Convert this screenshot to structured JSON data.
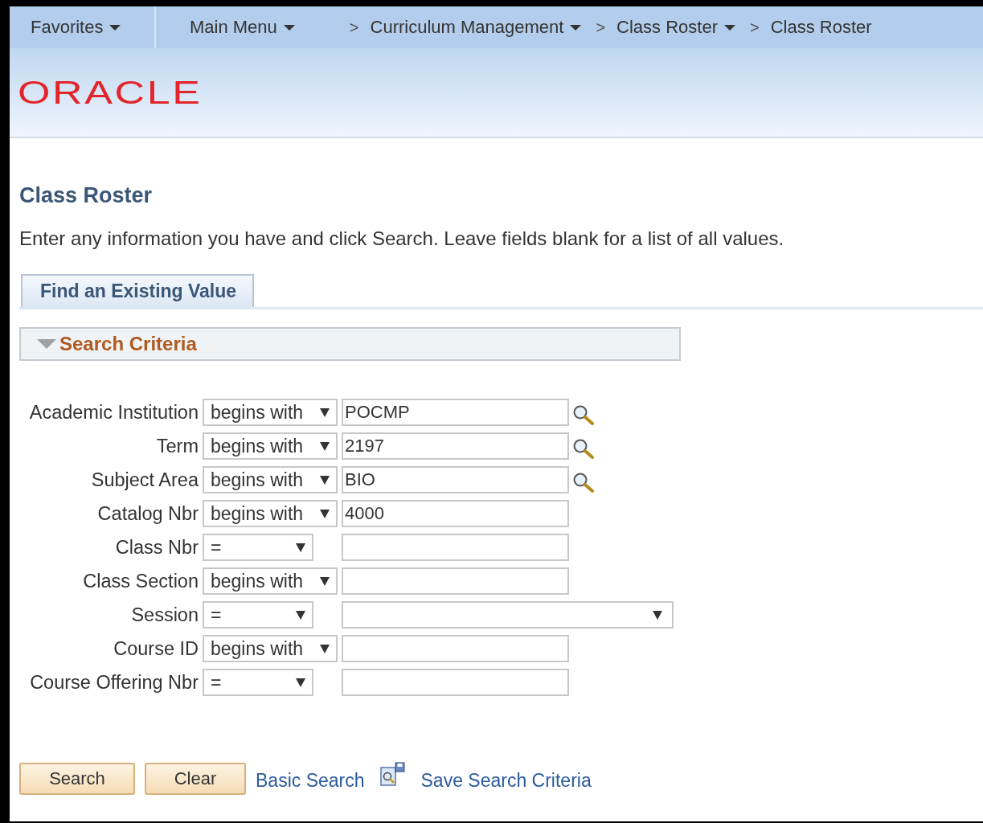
{
  "nav": [
    {
      "label": "Favorites",
      "has_menu": true
    },
    {
      "label": "Main Menu",
      "has_menu": true
    },
    {
      "label": "Curriculum Management",
      "has_menu": true,
      "separator": ">"
    },
    {
      "label": "Class Roster",
      "has_menu": true,
      "separator": ">"
    },
    {
      "label": "Class Roster",
      "has_menu": false,
      "separator": ">"
    }
  ],
  "logo": "ORACLE",
  "page_title": "Class Roster",
  "instructions": "Enter any information you have and click Search. Leave fields blank for a list of all values.",
  "tabs": [
    {
      "label": "Find an Existing Value",
      "selected": true
    }
  ],
  "section": {
    "title": "Search Criteria",
    "expanded": true
  },
  "fields": [
    {
      "label": "Academic Institution",
      "kind": "pattern",
      "operator": "begins with",
      "value": "POCMP",
      "lookup": true
    },
    {
      "label": "Term",
      "kind": "pattern",
      "operator": "begins with",
      "value": "2197",
      "lookup": true
    },
    {
      "label": "Subject Area",
      "kind": "pattern",
      "operator": "begins with",
      "value": "BIO",
      "lookup": true
    },
    {
      "label": "Catalog Nbr",
      "kind": "pattern",
      "operator": "begins with",
      "value": "4000",
      "lookup": false
    },
    {
      "label": "Class Nbr",
      "kind": "exact",
      "operator": "=",
      "lookup": false
    },
    {
      "label": "Class Section",
      "kind": "pattern",
      "operator": "begins with",
      "lookup": false
    },
    {
      "label": "Session",
      "kind": "choice",
      "operator": "=",
      "lookup": false
    },
    {
      "label": "Course ID",
      "kind": "pattern",
      "operator": "begins with",
      "lookup": false
    },
    {
      "label": "Course Offering Nbr",
      "kind": "exact",
      "operator": "=",
      "lookup": false
    }
  ],
  "buttons": [
    "Search",
    "Clear"
  ],
  "links": [
    {
      "label": "Basic Search",
      "icon": false
    },
    {
      "label": "Save Search Criteria",
      "icon": true
    }
  ]
}
